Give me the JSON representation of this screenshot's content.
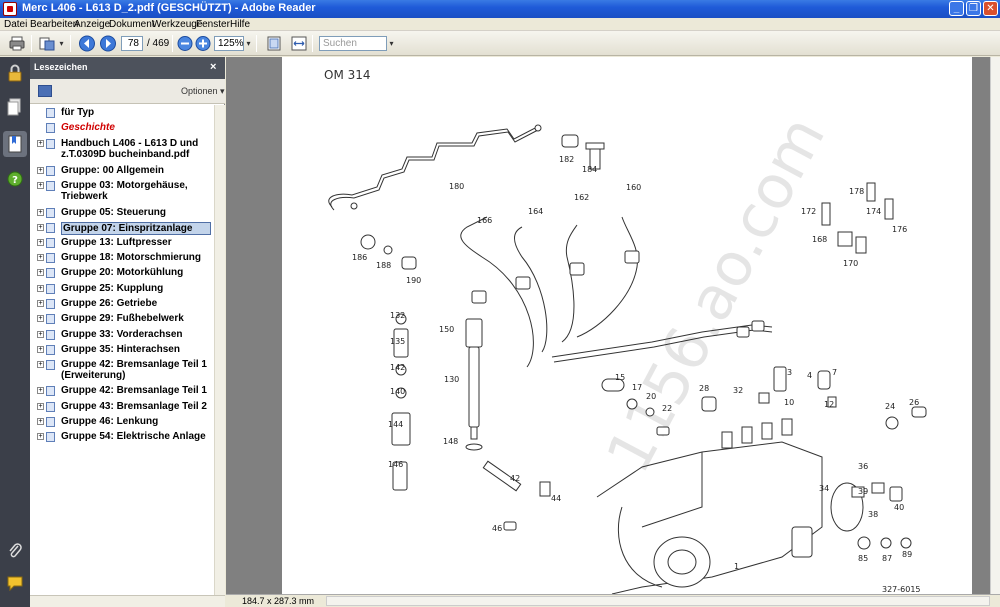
{
  "window": {
    "title": "Merc L406 - L613 D_2.pdf (GESCHÜTZT) - Adobe Reader",
    "minimize": "_",
    "restore": "❐",
    "close": "✕"
  },
  "menu": [
    "Datei",
    "Bearbeiten",
    "Anzeige",
    "Dokument",
    "Werkzeuge",
    "Fenster",
    "Hilfe"
  ],
  "toolbar": {
    "page_current": "78",
    "page_total": "/ 469",
    "zoom": "125%",
    "search_placeholder": "Suchen"
  },
  "bookmarks_panel": {
    "title": "Lesezeichen",
    "close": "×",
    "options": "Optionen ▾",
    "items": [
      {
        "label": "für Typ",
        "expandable": false
      },
      {
        "label": "Geschichte",
        "expandable": false,
        "color": "#d00000"
      },
      {
        "label": "Handbuch L406 - L613 D und z.T.0309D bucheinband.pdf",
        "expandable": true
      },
      {
        "label": "Gruppe: 00 Allgemein",
        "expandable": true
      },
      {
        "label": "Gruppe 03: Motorgehäuse, Triebwerk",
        "expandable": true
      },
      {
        "label": "Gruppe 05: Steuerung",
        "expandable": true
      },
      {
        "label": "Gruppe 07: Einspritzanlage",
        "expandable": true,
        "selected": true
      },
      {
        "label": "Gruppe 13: Luftpresser",
        "expandable": true
      },
      {
        "label": "Gruppe 18: Motorschmierung",
        "expandable": true
      },
      {
        "label": "Gruppe 20: Motorkühlung",
        "expandable": true
      },
      {
        "label": "Gruppe 25: Kupplung",
        "expandable": true
      },
      {
        "label": "Gruppe 26: Getriebe",
        "expandable": true
      },
      {
        "label": "Gruppe 29: Fußhebelwerk",
        "expandable": true
      },
      {
        "label": "Gruppe 33: Vorderachsen",
        "expandable": true
      },
      {
        "label": "Gruppe 35: Hinterachsen",
        "expandable": true
      },
      {
        "label": "Gruppe 42: Bremsanlage Teil 1 (Erweiterung)",
        "expandable": true
      },
      {
        "label": "Gruppe 42: Bremsanlage Teil 1",
        "expandable": true
      },
      {
        "label": "Gruppe 43: Bremsanlage Teil 2",
        "expandable": true
      },
      {
        "label": "Gruppe 46: Lenkung",
        "expandable": true
      },
      {
        "label": "Gruppe 54: Elektrische Anlage",
        "expandable": true
      }
    ]
  },
  "status": {
    "page_size": "184.7 x 287.3 mm"
  },
  "document": {
    "heading": "OM 314",
    "part_numbers": [
      "1",
      "3",
      "4",
      "7",
      "10",
      "12",
      "15",
      "17",
      "20",
      "22",
      "24",
      "26",
      "28",
      "32",
      "34",
      "36",
      "38",
      "39",
      "40",
      "42",
      "44",
      "46",
      "85",
      "87",
      "89",
      "130",
      "132",
      "135",
      "140",
      "142",
      "144",
      "146",
      "148",
      "150",
      "160",
      "162",
      "164",
      "166",
      "168",
      "170",
      "172",
      "174",
      "176",
      "178",
      "180",
      "182",
      "184",
      "186",
      "188",
      "190"
    ],
    "footer_code": "327-6015"
  }
}
